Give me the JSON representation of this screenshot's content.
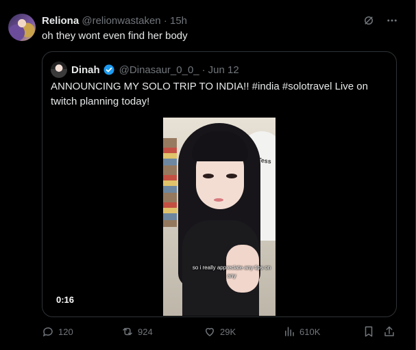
{
  "author": {
    "name": "Reliona",
    "handle": "@relionwastaken",
    "separator": "·",
    "time": "15h",
    "text": "oh they wont even find her body"
  },
  "quoted": {
    "name": "Dinah",
    "handle": "@Dinasaur_0_0_",
    "separator": "·",
    "date": "Jun 12",
    "text": "ANNOUNCING MY SOLO TRIP TO INDIA!! #india #solotravel Live on twitch planning today!",
    "video": {
      "caption": "so i really appreciate any tips on any",
      "duration": "0:16",
      "shirt_text": "Tess"
    }
  },
  "actions": {
    "replies": "120",
    "reposts": "924",
    "likes": "29K",
    "views": "610K"
  },
  "colors": {
    "background": "#000000",
    "text": "#e7e9ea",
    "muted": "#71767b",
    "border": "#2f3336",
    "verified": "#1d9bf0"
  }
}
